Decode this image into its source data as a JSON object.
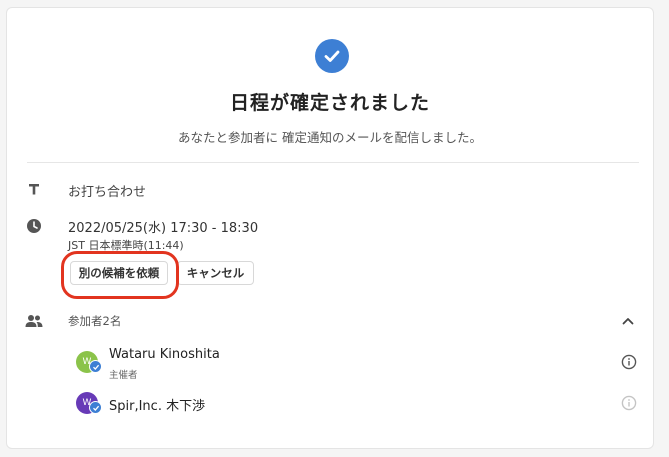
{
  "confirmation": {
    "title": "日程が確定されました",
    "message": "あなたと参加者に 確定通知のメールを配信しました。"
  },
  "event": {
    "title": "お打ち合わせ",
    "datetime": "2022/05/25(水) 17:30 - 18:30",
    "timezone": "JST 日本標準時(11:44)"
  },
  "actions": {
    "request_alternative": "別の候補を依頼",
    "cancel": "キャンセル"
  },
  "participants": {
    "label": "参加者2名",
    "items": [
      {
        "name": "Wataru Kinoshita",
        "role": "主催者",
        "initial": "W",
        "avatar_color": "#8bc34a"
      },
      {
        "name": "Spir,Inc. 木下渉",
        "role": "",
        "initial": "W",
        "avatar_color": "#673ab7"
      }
    ]
  },
  "colors": {
    "accent": "#3d7fd4",
    "highlight": "#e2341f"
  }
}
